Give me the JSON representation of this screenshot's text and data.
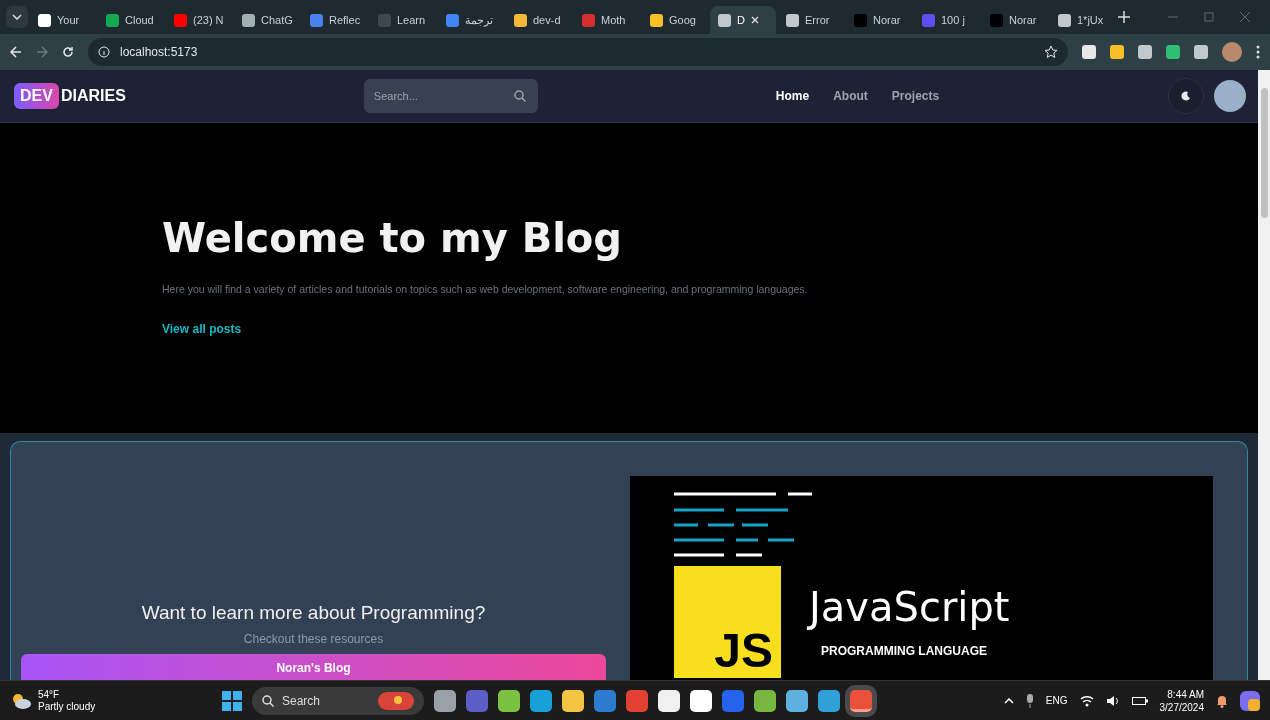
{
  "browser": {
    "tabs": [
      {
        "title": "Your",
        "color": "#ffffff",
        "selected": false
      },
      {
        "title": "Cloud",
        "color": "#13aa52",
        "selected": false
      },
      {
        "title": "(23) N",
        "color": "#ff0000",
        "selected": false
      },
      {
        "title": "ChatG",
        "color": "#a0b0b0",
        "selected": false
      },
      {
        "title": "Reflec",
        "color": "#4a80f0",
        "selected": false
      },
      {
        "title": "Learn",
        "color": "#3a4a50",
        "selected": false
      },
      {
        "title": "ترجمة",
        "color": "#4285f4",
        "selected": false
      },
      {
        "title": "dev-d",
        "color": "#f5b83a",
        "selected": false
      },
      {
        "title": "Moth",
        "color": "#d32f2f",
        "selected": false
      },
      {
        "title": "Goog",
        "color": "#f6c026",
        "selected": false
      },
      {
        "title": "D",
        "color": "#c0c8cc",
        "selected": true
      },
      {
        "title": "Error",
        "color": "#c0c8cc",
        "selected": false
      },
      {
        "title": "Norar",
        "color": "#000000",
        "selected": false
      },
      {
        "title": "100 j",
        "color": "#5a4ff0",
        "selected": false
      },
      {
        "title": "Norar",
        "color": "#000000",
        "selected": false
      },
      {
        "title": "1*jUx",
        "color": "#c0c8cc",
        "selected": false
      }
    ],
    "address": "localhost:5173",
    "extensions": [
      {
        "color": "#e8e8e8"
      },
      {
        "color": "#f6c026"
      },
      {
        "color": "#c0c8cc"
      },
      {
        "color": "#2fbf71"
      },
      {
        "color": "#c0c8cc"
      }
    ]
  },
  "site": {
    "logo_badge": "DEV",
    "logo_text": "DIARIES",
    "search_placeholder": "Search...",
    "nav": [
      {
        "label": "Home",
        "selected": true
      },
      {
        "label": "About",
        "selected": false
      },
      {
        "label": "Projects",
        "selected": false
      }
    ]
  },
  "hero": {
    "title": "Welcome to my Blog",
    "text": "Here you will find a variety of articles and tutorials on topics such as web development, software engineering, and programming languages.",
    "link": "View all posts"
  },
  "resources": {
    "title": "Want to learn more about Programming?",
    "subtitle": "Checkout these resources",
    "button": "Noran's Blog",
    "image": {
      "badge": "JS",
      "title": "JavaScript",
      "subtitle": "PROGRAMMING LANGUAGE"
    }
  },
  "taskbar": {
    "weather": {
      "temperature": "54°F",
      "condition": "Partly cloudy"
    },
    "search": "Search",
    "apps": [
      {
        "color": "#9aa0a6",
        "selected": false
      },
      {
        "color": "#5b5fc7",
        "selected": false
      },
      {
        "color": "#7cc242",
        "selected": false
      },
      {
        "color": "#1aa0d8",
        "selected": false
      },
      {
        "color": "#f4c542",
        "selected": false
      },
      {
        "color": "#2b7bd1",
        "selected": false
      },
      {
        "color": "#e34133",
        "selected": false
      },
      {
        "color": "#f0f0f0",
        "selected": false
      },
      {
        "color": "#ffffff",
        "selected": false
      },
      {
        "color": "#2563eb",
        "selected": false
      },
      {
        "color": "#76b83f",
        "selected": false
      },
      {
        "color": "#5db0e0",
        "selected": false
      },
      {
        "color": "#2fa0d8",
        "selected": false
      },
      {
        "color": "#e8503a",
        "selected": true
      }
    ],
    "language": "ENG",
    "time": "8:44 AM",
    "date": "3/27/2024"
  }
}
